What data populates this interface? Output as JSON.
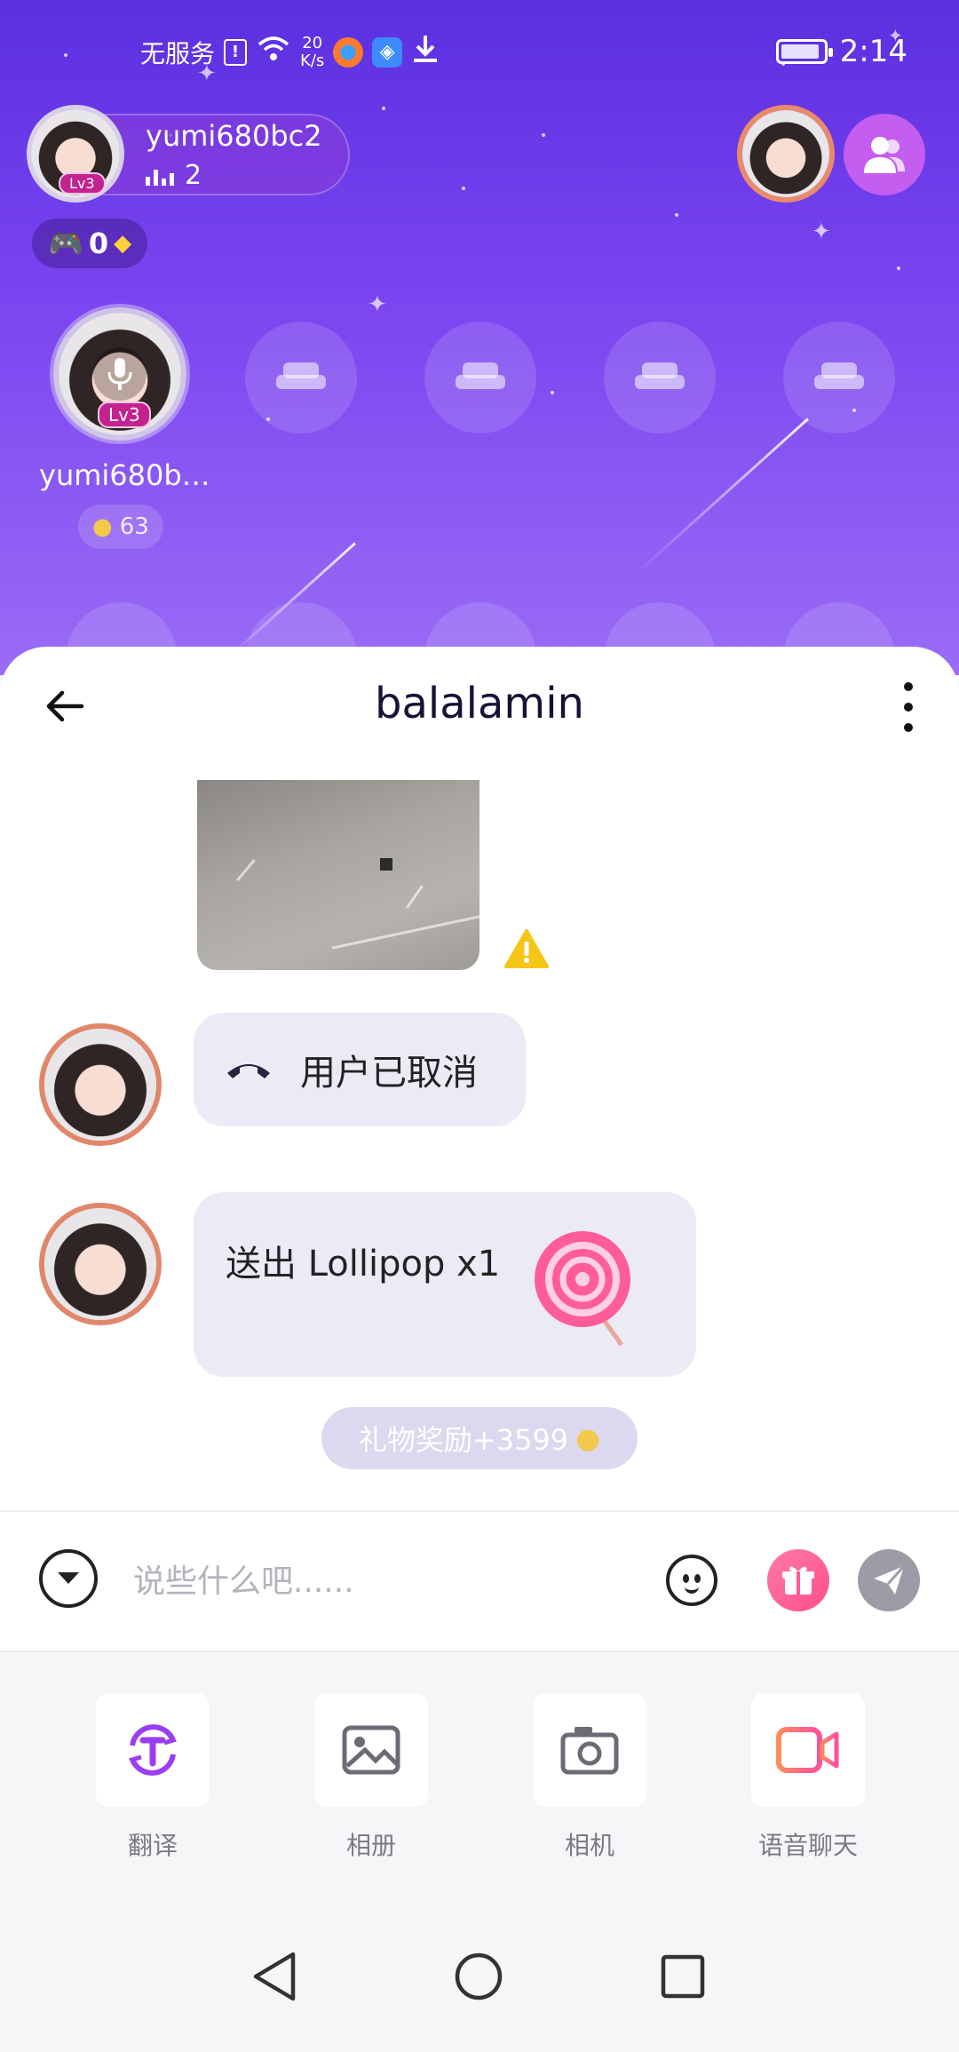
{
  "status_bar": {
    "carrier": "无服务",
    "net_speed_value": "20",
    "net_speed_unit": "K/s",
    "time": "2:14"
  },
  "room": {
    "host": {
      "name": "yumi680bc2",
      "level": "Lv3",
      "listeners": "2"
    },
    "game_coins": "0",
    "seat_user": {
      "name": "yumi680b…",
      "level": "Lv3",
      "coins": "63"
    }
  },
  "chat": {
    "title": "balalamin",
    "messages": [
      {
        "type": "image",
        "warning": true
      },
      {
        "type": "call",
        "text": "用户已取消"
      },
      {
        "type": "gift",
        "text": "送出 Lollipop x1"
      }
    ],
    "reward_text": "礼物奖励+3599"
  },
  "input": {
    "placeholder": "说些什么吧......"
  },
  "tools": [
    {
      "label": "翻译",
      "icon": "translate-icon"
    },
    {
      "label": "相册",
      "icon": "album-icon"
    },
    {
      "label": "相机",
      "icon": "camera-icon"
    },
    {
      "label": "语音聊天",
      "icon": "video-call-icon"
    }
  ],
  "colors": {
    "primary": "#7b45f0",
    "bubble": "#eceaf5",
    "gift": "#ff4f88",
    "warning": "#f5c518"
  }
}
